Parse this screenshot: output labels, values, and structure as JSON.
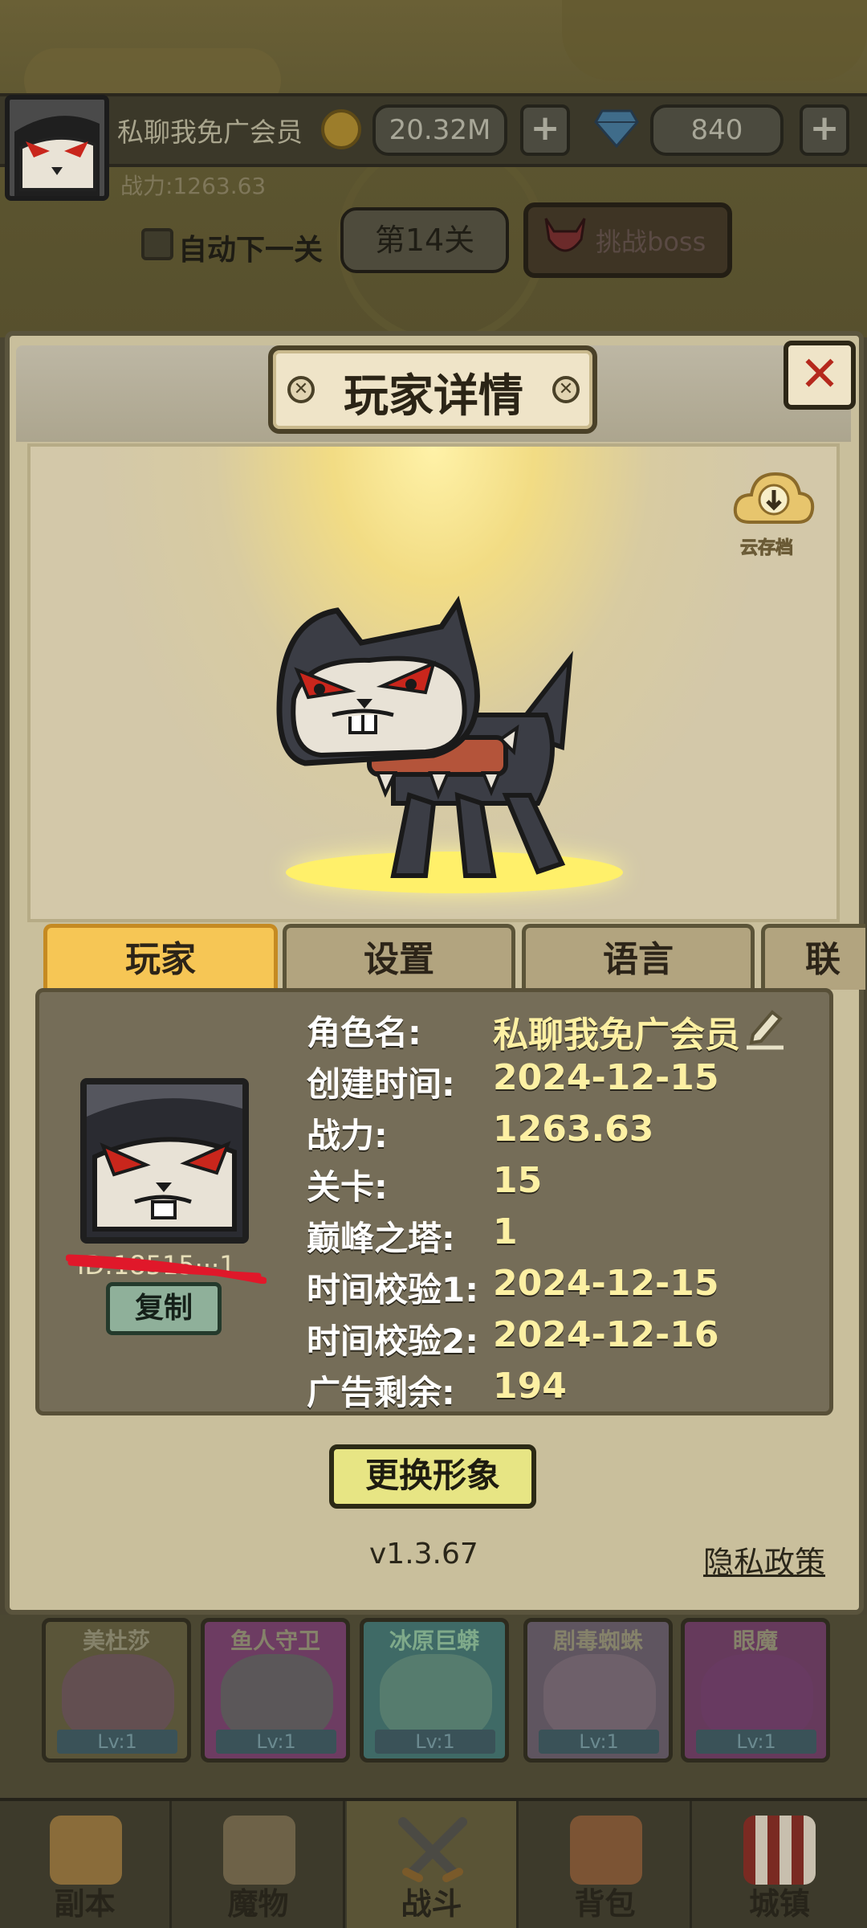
{
  "top_bar": {
    "player_name": "私聊我免广会员",
    "gold": "20.32M",
    "gems": "840",
    "plus": "+",
    "power": "战力:1263.63",
    "auto_next": "自动下一关",
    "stage": "第14关",
    "boss_button": "挑战boss"
  },
  "modal": {
    "title": "玩家详情",
    "close": "✕",
    "cloud_save": "云存档",
    "tabs": [
      "玩家",
      "设置",
      "语言",
      "联"
    ],
    "player_id": "ID:18515···1",
    "copy": "复制",
    "info_rows": [
      {
        "label": "角色名:",
        "value": "私聊我免广会员"
      },
      {
        "label": "创建时间:",
        "value": "2024-12-15"
      },
      {
        "label": "战力:",
        "value": "1263.63"
      },
      {
        "label": "关卡:",
        "value": "15"
      },
      {
        "label": "巅峰之塔:",
        "value": "1"
      },
      {
        "label": "时间校验1:",
        "value": "2024-12-15"
      },
      {
        "label": "时间校验2:",
        "value": "2024-12-16"
      },
      {
        "label": "广告剩余:",
        "value": "194"
      }
    ],
    "change_look": "更换形象",
    "version": "v1.3.67",
    "privacy": "隐私政策"
  },
  "monsters": [
    {
      "name": "美杜莎",
      "level": "Lv:1",
      "color": "#7a4a76"
    },
    {
      "name": "鱼人守卫",
      "level": "Lv:1",
      "color": "#8a3f7a"
    },
    {
      "name": "冰原巨蟒",
      "level": "Lv:1",
      "color": "#4f8a86"
    },
    {
      "name": "剧毒蜘蛛",
      "level": "Lv:1",
      "color": "#6e5a68"
    },
    {
      "name": "眼魔",
      "level": "Lv:1",
      "color": "#7a3a66"
    }
  ],
  "nav": [
    {
      "label": "副本",
      "icon": "map-icon"
    },
    {
      "label": "魔物",
      "icon": "monster-helmet-icon"
    },
    {
      "label": "战斗",
      "icon": "crossed-swords-icon"
    },
    {
      "label": "背包",
      "icon": "backpack-icon"
    },
    {
      "label": "城镇",
      "icon": "town-shop-icon"
    }
  ],
  "colors": {
    "tab_active": "#f6c655",
    "value_text": "#fdf0a3",
    "close_x": "#b5281c"
  }
}
